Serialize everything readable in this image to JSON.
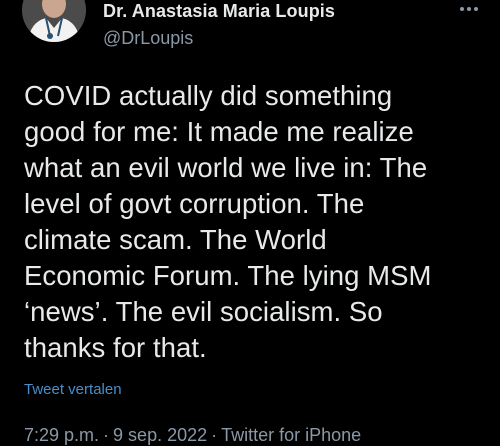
{
  "author": {
    "display_name": "Dr. Anastasia Maria Loupis",
    "handle": "@DrLoupis"
  },
  "more_icon": "more-horizontal-icon",
  "tweet": {
    "text": "COVID actually did something\ngood for me: It made me realize\nwhat an evil world we live in: The\nlevel of govt corruption. The\nclimate scam. The World\nEconomic Forum. The lying MSM\n‘news’. The evil socialism. So\nthanks for that.",
    "translate_label": "Tweet vertalen"
  },
  "meta": {
    "time": "7:29 p.m.",
    "separator": "·",
    "date": "9 sep. 2022",
    "source": "Twitter for iPhone"
  },
  "colors": {
    "background": "#000000",
    "text": "#e7e9ea",
    "secondary": "#8b98a5",
    "link": "#4a8ec9"
  }
}
